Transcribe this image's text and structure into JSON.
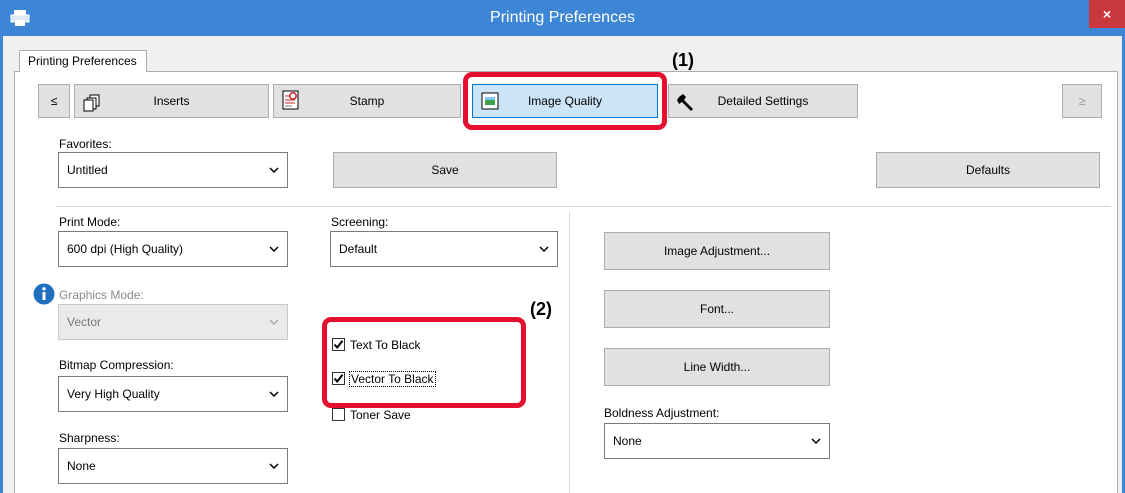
{
  "window": {
    "title": "Printing Preferences",
    "close_glyph": "×",
    "tab_label": "Printing Preferences"
  },
  "toolbar": {
    "prev_glyph": "≤",
    "next_glyph": "≥",
    "items": [
      {
        "label": "Inserts",
        "icon": "inserts-icon"
      },
      {
        "label": "Stamp",
        "icon": "stamp-icon"
      },
      {
        "label": "Image Quality",
        "icon": "image-quality-icon"
      },
      {
        "label": "Detailed Settings",
        "icon": "wrench-icon"
      }
    ]
  },
  "favorites": {
    "label": "Favorites:",
    "value": "Untitled",
    "save_label": "Save",
    "defaults_label": "Defaults"
  },
  "left": {
    "print_mode_label": "Print Mode:",
    "print_mode_value": "600 dpi (High Quality)",
    "graphics_mode_label": "Graphics Mode:",
    "graphics_mode_value": "Vector",
    "bitmap_label": "Bitmap Compression:",
    "bitmap_value": "Very High Quality",
    "sharpness_label": "Sharpness:",
    "sharpness_value": "None"
  },
  "middle": {
    "screening_label": "Screening:",
    "screening_value": "Default",
    "checkboxes": [
      {
        "label": "Text To Black",
        "checked": true
      },
      {
        "label": "Vector To Black",
        "checked": true
      },
      {
        "label": "Toner Save",
        "checked": false
      }
    ]
  },
  "right": {
    "image_adjustment_label": "Image Adjustment...",
    "font_label": "Font...",
    "line_width_label": "Line Width...",
    "boldness_label": "Boldness Adjustment:",
    "boldness_value": "None"
  },
  "annotations": {
    "callout1": "(1)",
    "callout2": "(2)"
  },
  "colors": {
    "titlebar": "#3d86d5",
    "close": "#c8383d",
    "callout": "#e3102f",
    "active_tab": "#cce4f7"
  }
}
